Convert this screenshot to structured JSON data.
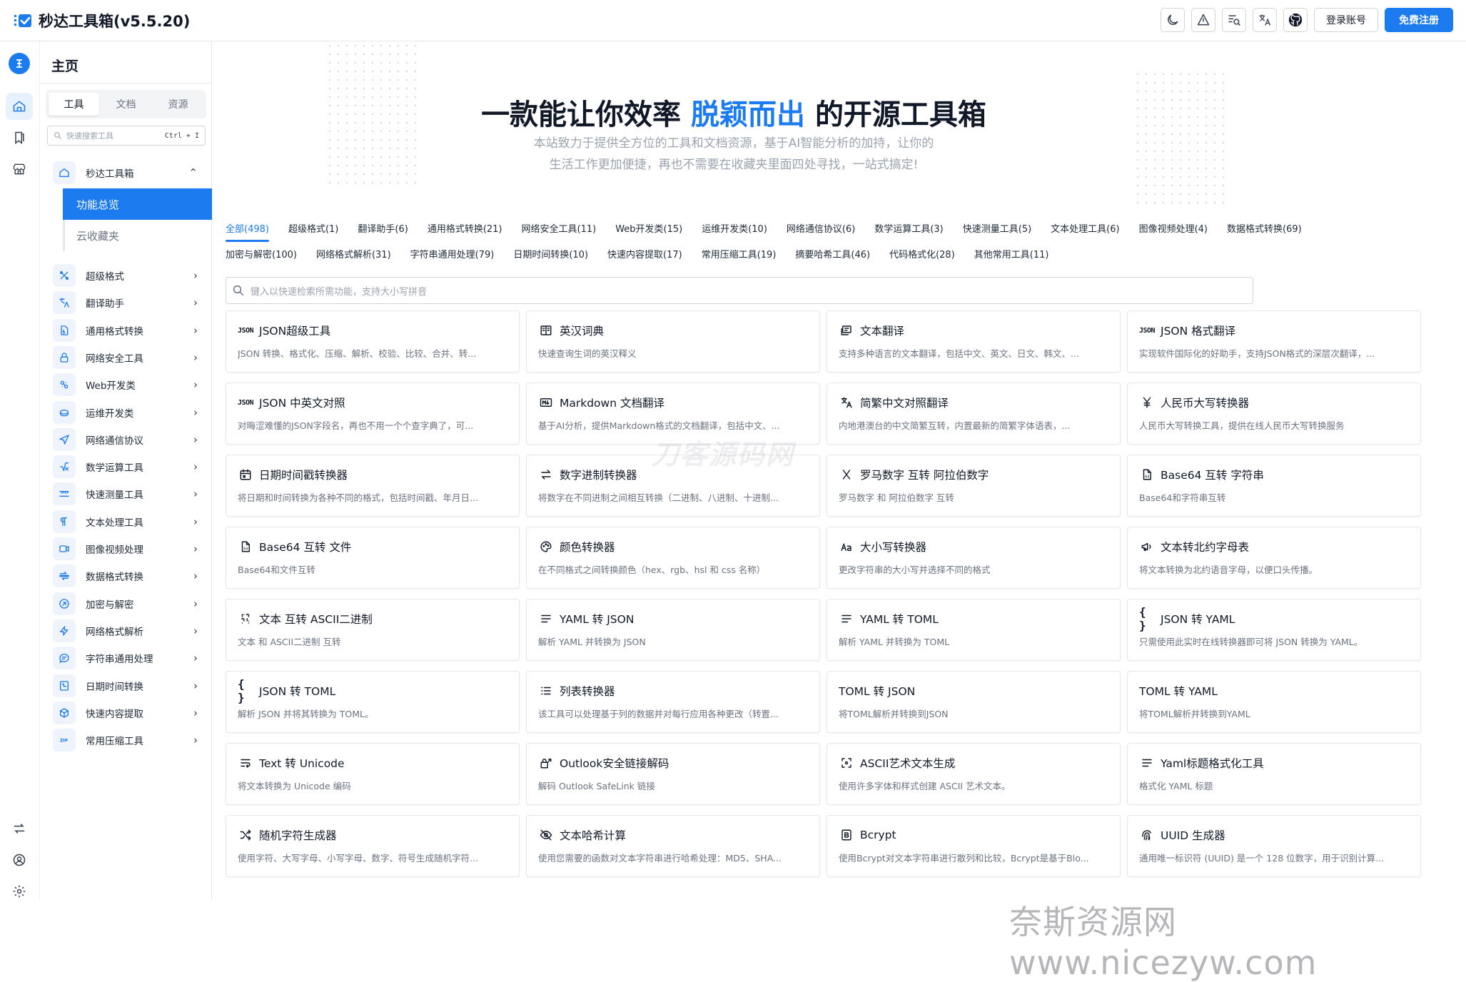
{
  "header": {
    "app_title": "秒达工具箱(v5.5.20)",
    "login_label": "登录账号",
    "register_label": "免费注册",
    "accent": "#1d7bf0",
    "icons": [
      "moon-icon",
      "theme-icon",
      "search-doc-icon",
      "translate-icon",
      "github-icon"
    ]
  },
  "menu": {
    "title": "主页",
    "tabs": [
      "工具",
      "文档",
      "资源"
    ],
    "search": {
      "placeholder": "快速搜索工具",
      "shortcut": "Ctrl + I"
    },
    "group": {
      "label": "秒达工具箱",
      "items": [
        "功能总览",
        "云收藏夹"
      ]
    },
    "items": [
      "超级格式",
      "翻译助手",
      "通用格式转换",
      "网络安全工具",
      "Web开发类",
      "运维开发类",
      "网络通信协议",
      "数学运算工具",
      "快速测量工具",
      "文本处理工具",
      "图像视频处理",
      "数据格式转换",
      "加密与解密",
      "网络格式解析",
      "字符串通用处理",
      "日期时间转换",
      "快速内容提取",
      "常用压缩工具"
    ]
  },
  "hero": {
    "title_pre": "一款能让你效率",
    "title_hl": "脱颖而出",
    "title_post": "的开源工具箱",
    "subtitle_1": "本站致力于提供全方位的工具和文档资源，基于AI智能分析的加持，让你的",
    "subtitle_2": "生活工作更加便捷，再也不需要在收藏夹里面四处寻找，一站式搞定!"
  },
  "categories_row1": [
    "全部(498)",
    "超级格式(1)",
    "翻译助手(6)",
    "通用格式转换(21)",
    "网络安全工具(11)",
    "Web开发类(15)",
    "运维开发类(10)",
    "网络通信协议(6)",
    "数学运算工具(3)",
    "快速测量工具(5)",
    "文本处理工具(6)",
    "图像视频处理(4)",
    "数据格式转换(69)"
  ],
  "categories_row2": [
    "加密与解密(100)",
    "网络格式解析(31)",
    "字符串通用处理(79)",
    "日期时间转换(10)",
    "快速内容提取(17)",
    "常用压缩工具(19)",
    "摘要哈希工具(46)",
    "代码格式化(28)",
    "其他常用工具(11)"
  ],
  "search": {
    "placeholder": "键入以快速检索所需功能，支持大小写拼音"
  },
  "cards": [
    {
      "icon": "json-icon",
      "title": "JSON超级工具",
      "desc": "JSON 转换、格式化、压缩、解析、校验、比较、合并、转..."
    },
    {
      "icon": "dictionary-icon",
      "title": "英汉词典",
      "desc": "快速查询生词的英汉释义"
    },
    {
      "icon": "text-translate-icon",
      "title": "文本翻译",
      "desc": "支持多种语言的文本翻译，包括中文、英文、日文、韩文、..."
    },
    {
      "icon": "json-icon",
      "title": "JSON 格式翻译",
      "desc": "实现软件国际化的好助手，支持JSON格式的深层次翻译，..."
    },
    {
      "icon": "json-icon",
      "title": "JSON 中英文对照",
      "desc": "对晦涩难懂的JSON字段名，再也不用一个个查字典了，可..."
    },
    {
      "icon": "markdown-icon",
      "title": "Markdown 文档翻译",
      "desc": "基于AI分析，提供Markdown格式的文档翻译，包括中文、..."
    },
    {
      "icon": "translate-icon",
      "title": "简繁中文对照翻译",
      "desc": "内地港澳台的中文简繁互转，内置最新的简繁字体语表，..."
    },
    {
      "icon": "yen-icon",
      "title": "人民币大写转换器",
      "desc": "人民币大写转换工具，提供在线人民币大写转换服务"
    },
    {
      "icon": "calendar-icon",
      "title": "日期时间戳转换器",
      "desc": "将日期和时间转换为各种不同的格式，包括时间戳、年月日..."
    },
    {
      "icon": "swap-icon",
      "title": "数字进制转换器",
      "desc": "将数字在不同进制之间相互转换（二进制、八进制、十进制..."
    },
    {
      "icon": "roman-x-icon",
      "title": "罗马数字 互转 阿拉伯数字",
      "desc": "罗马数字 和 阿拉伯数字 互转"
    },
    {
      "icon": "base64-file-icon",
      "title": "Base64 互转 字符串",
      "desc": "Base64和字符串互转"
    },
    {
      "icon": "base64-file-icon",
      "title": "Base64 互转 文件",
      "desc": "Base64和文件互转"
    },
    {
      "icon": "palette-icon",
      "title": "颜色转换器",
      "desc": "在不同格式之间转换颜色（hex、rgb、hsl 和 css 名称）"
    },
    {
      "icon": "letter-case-icon",
      "title": "大小写转换器",
      "desc": "更改字符串的大小写并选择不同的格式"
    },
    {
      "icon": "megaphone-icon",
      "title": "文本转北约字母表",
      "desc": "将文本转换为北约语音字母，以便口头传播。"
    },
    {
      "icon": "binary-icon",
      "title": "文本 互转 ASCII二进制",
      "desc": "文本 和 ASCII二进制 互转"
    },
    {
      "icon": "lines-icon",
      "title": "YAML 转 JSON",
      "desc": "解析 YAML 并转换为 JSON"
    },
    {
      "icon": "lines-icon",
      "title": "YAML 转 TOML",
      "desc": "解析 YAML 并转换为 TOML"
    },
    {
      "icon": "braces-icon",
      "title": "JSON 转 YAML",
      "desc": "只需使用此实时在线转换器即可将 JSON 转换为 YAML。"
    },
    {
      "icon": "braces-icon",
      "title": "JSON 转 TOML",
      "desc": "解析 JSON 并将其转换为 TOML。"
    },
    {
      "icon": "list-icon",
      "title": "列表转换器",
      "desc": "该工具可以处理基于列的数据并对每行应用各种更改（转置..."
    },
    {
      "icon": "",
      "title": "TOML 转 JSON",
      "desc": "将TOML解析并转换到JSON"
    },
    {
      "icon": "",
      "title": "TOML 转 YAML",
      "desc": "将TOML解析并转换到YAML"
    },
    {
      "icon": "text-wrap-icon",
      "title": "Text 转 Unicode",
      "desc": "将文本转换为 Unicode 编码"
    },
    {
      "icon": "safelink-icon",
      "title": "Outlook安全链接解码",
      "desc": "解码 Outlook SafeLink 链接"
    },
    {
      "icon": "focus-icon",
      "title": "ASCII艺术文本生成",
      "desc": "使用许多字体和样式创建 ASCII 艺术文本。"
    },
    {
      "icon": "lines-icon",
      "title": "Yaml标题格式化工具",
      "desc": "格式化 YAML 标题"
    },
    {
      "icon": "shuffle-icon",
      "title": "随机字符生成器",
      "desc": "使用字符、大写字母、小写字母、数字、符号生成随机字符..."
    },
    {
      "icon": "eye-off-icon",
      "title": "文本哈希计算",
      "desc": "使用您需要的函数对文本字符串进行哈希处理：MD5、SHA..."
    },
    {
      "icon": "bcrypt-icon",
      "title": "Bcrypt",
      "desc": "使用Bcrypt对文本字符串进行散列和比较，Bcrypt是基于Blo..."
    },
    {
      "icon": "fingerprint-icon",
      "title": "UUID 生成器",
      "desc": "通用唯一标识符 (UUID) 是一个 128 位数字，用于识别计算..."
    }
  ],
  "watermarks": {
    "center": "刀客源码网",
    "corner": "奈斯资源网www.nicezyw.com"
  }
}
